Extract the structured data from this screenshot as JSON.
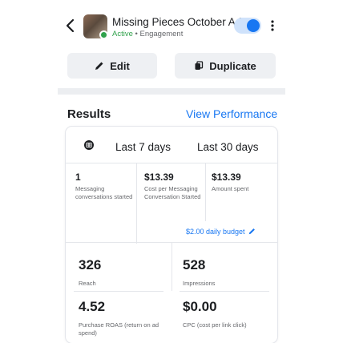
{
  "header": {
    "title": "Missing Pieces October Ad",
    "status": "Active",
    "separator": " • ",
    "objective": "Engagement",
    "toggle_on": true
  },
  "actions": {
    "edit_label": "Edit",
    "duplicate_label": "Duplicate"
  },
  "results": {
    "title": "Results",
    "view_performance": "View Performance",
    "tabs": [
      {
        "label": "Last 7 days",
        "icon": "calendar-grid-icon"
      },
      {
        "label": "Last 30 days"
      }
    ],
    "top_metrics": [
      {
        "value": "1",
        "label": "Messaging conversations started"
      },
      {
        "value": "$13.39",
        "label": "Cost per Messaging Conversation Started"
      },
      {
        "value": "$13.39",
        "label": "Amount spent"
      }
    ],
    "budget_label": "$2.00 daily budget",
    "metrics": [
      {
        "value": "326",
        "label": "Reach"
      },
      {
        "value": "528",
        "label": "Impressions"
      },
      {
        "value": "4.52",
        "label": "Purchase ROAS (return on ad spend)"
      },
      {
        "value": "$0.00",
        "label": "CPC (cost per link click)"
      }
    ]
  },
  "colors": {
    "accent": "#1877f2",
    "active_green": "#31a24c",
    "button_bg": "#eef0f3"
  }
}
